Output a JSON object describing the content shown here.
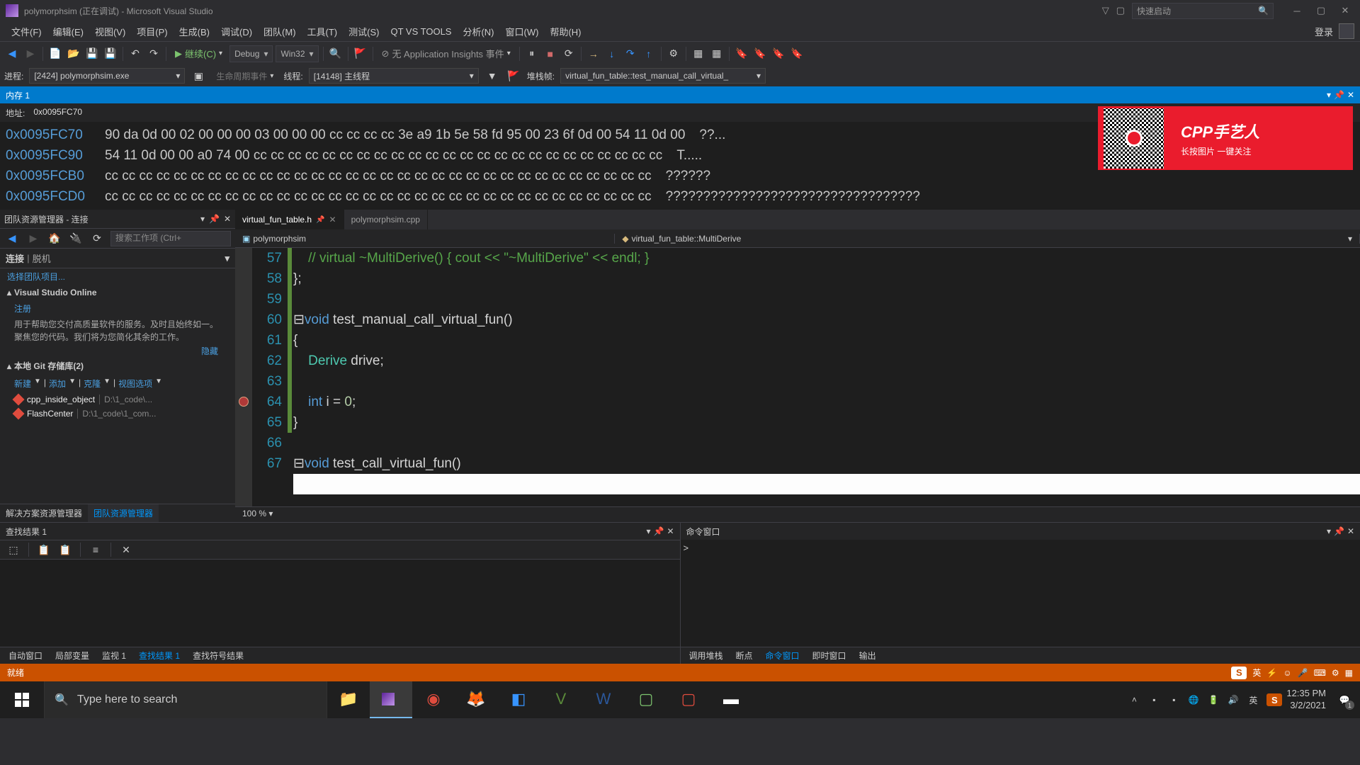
{
  "title": "polymorphsim (正在调试) - Microsoft Visual Studio",
  "quick_launch_placeholder": "快速启动",
  "login_label": "登录",
  "menu": [
    "文件(F)",
    "编辑(E)",
    "视图(V)",
    "项目(P)",
    "生成(B)",
    "调试(D)",
    "团队(M)",
    "工具(T)",
    "测试(S)",
    "QT VS TOOLS",
    "分析(N)",
    "窗口(W)",
    "帮助(H)"
  ],
  "toolbar": {
    "continue": "继续(C)",
    "config": "Debug",
    "platform": "Win32",
    "insights": "无 Application Insights 事件"
  },
  "debugbar": {
    "process_label": "进程:",
    "process_value": "[2424] polymorphsim.exe",
    "lifecycle": "生命周期事件",
    "thread_label": "线程:",
    "thread_value": "[14148] 主线程",
    "stackframe_label": "堆栈帧:",
    "stackframe_value": "virtual_fun_table::test_manual_call_virtual_"
  },
  "memory": {
    "title": "内存 1",
    "addr_label": "地址:",
    "addr_value": "0x0095FC70",
    "rows": [
      {
        "addr": "0x0095FC70",
        "hex": "90 da 0d 00 02 00 00 00 03 00 00 00 cc cc cc cc 3e a9 1b 5e 58 fd 95 00 23 6f 0d 00 54 11 0d 00",
        "ascii": "??..."
      },
      {
        "addr": "0x0095FC90",
        "hex": "54 11 0d 00 00 a0 74 00 cc cc cc cc cc cc cc cc cc cc cc cc cc cc cc cc cc cc cc cc cc cc cc cc",
        "ascii": "T....."
      },
      {
        "addr": "0x0095FCB0",
        "hex": "cc cc cc cc cc cc cc cc cc cc cc cc cc cc cc cc cc cc cc cc cc cc cc cc cc cc cc cc cc cc cc cc",
        "ascii": "??????"
      },
      {
        "addr": "0x0095FCD0",
        "hex": "cc cc cc cc cc cc cc cc cc cc cc cc cc cc cc cc cc cc cc cc cc cc cc cc cc cc cc cc cc cc cc cc",
        "ascii": "??????????????????????????????????"
      }
    ]
  },
  "overlay": {
    "title": "CPP手艺人",
    "sub": "长按图片    一键关注"
  },
  "team_panel": {
    "title": "团队资源管理器 - 连接",
    "search_placeholder": "搜索工作项 (Ctrl+",
    "connect_label": "连接",
    "offline_label": "脱机",
    "choose_project": "选择团队项目...",
    "vsonline": "Visual Studio Online",
    "register": "注册",
    "vsonline_desc": "用于帮助您交付高质量软件的服务。及时且始终如一。聚焦您的代码。我们将为您简化其余的工作。",
    "hide": "隐藏",
    "git_header": "本地 Git 存储库(2)",
    "actions": [
      "新建",
      "添加",
      "克隆",
      "视图选项"
    ],
    "repos": [
      {
        "name": "cpp_inside_object",
        "path": "D:\\1_code\\..."
      },
      {
        "name": "FlashCenter",
        "path": "D:\\1_code\\1_com..."
      }
    ],
    "tabs": [
      "解决方案资源管理器",
      "团队资源管理器"
    ]
  },
  "editor": {
    "tabs": [
      {
        "name": "virtual_fun_table.h",
        "active": true,
        "pinned": true
      },
      {
        "name": "polymorphsim.cpp",
        "active": false
      }
    ],
    "bc_left": "polymorphsim",
    "bc_right": "virtual_fun_table::MultiDerive",
    "zoom": "100 %"
  },
  "code_lines": [
    {
      "n": 57,
      "mark": "g"
    },
    {
      "n": 58,
      "mark": "g"
    },
    {
      "n": 59,
      "mark": "g"
    },
    {
      "n": 60,
      "mark": "g"
    },
    {
      "n": 61,
      "mark": "g"
    },
    {
      "n": 62,
      "mark": "g"
    },
    {
      "n": 63,
      "mark": "g"
    },
    {
      "n": 64,
      "mark": "g",
      "bp": true
    },
    {
      "n": 65,
      "mark": "g"
    },
    {
      "n": 66,
      "mark": ""
    },
    {
      "n": 67,
      "mark": ""
    }
  ],
  "find_results": {
    "title": "查找结果 1"
  },
  "command_window": {
    "title": "命令窗口",
    "prompt": ">"
  },
  "bottom_tabs_left": [
    "自动窗口",
    "局部变量",
    "监视 1",
    "查找结果 1",
    "查找符号结果"
  ],
  "bottom_tabs_right": [
    "调用堆栈",
    "断点",
    "命令窗口",
    "即时窗口",
    "输出"
  ],
  "status": {
    "ready": "就绪",
    "ime_lang": "英"
  },
  "taskbar": {
    "search_placeholder": "Type here to search",
    "time": "12:35 PM",
    "date": "3/2/2021",
    "lang": "英",
    "notif": "1"
  }
}
